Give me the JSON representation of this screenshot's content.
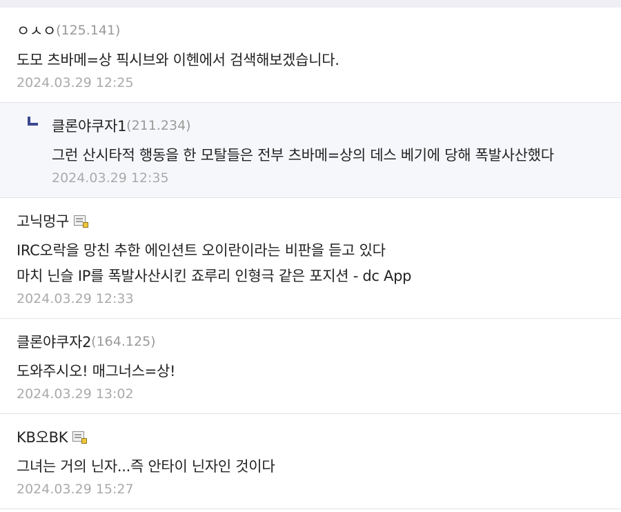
{
  "comments": [
    {
      "nick": "ㅇㅅㅇ",
      "ip": "(125.141)",
      "lines": [
        "도모 츠바메=상 픽시브와 이헨에서 검색해보겠습니다."
      ],
      "date": "2024.03.29 12:25"
    },
    {
      "nick": "클론야쿠자1",
      "ip": "(211.234)",
      "lines": [
        "그런 산시타적 행동을 한 모탈들은 전부 츠바메=상의 데스 베기에 당해 폭발사산했다"
      ],
      "date": "2024.03.29 12:35",
      "is_reply": true
    },
    {
      "nick": "고닉멍구",
      "member_icon": "fixed-member-icon",
      "lines": [
        "IRC오락을 망친 추한 에인션트 오이란이라는 비판을 듣고 있다",
        "마치 닌슬 IP를 폭발사산시킨 죠루리 인형극 같은 포지션 - dc App"
      ],
      "date": "2024.03.29 12:33"
    },
    {
      "nick": "클론야쿠자2",
      "ip": "(164.125)",
      "lines": [
        "도와주시오! 매그너스=상!"
      ],
      "date": "2024.03.29 13:02"
    },
    {
      "nick": "KB오BK",
      "member_icon": "fixed-member-icon",
      "lines": [
        "그녀는 거의 닌자...즉 안타이 닌자인 것이다"
      ],
      "date": "2024.03.29 15:27"
    }
  ],
  "colors": {
    "reply_background": "#f6f7fa",
    "reply_arrow": "#3b4890",
    "ip_text": "#999999",
    "date_text": "#aaaaaa"
  }
}
